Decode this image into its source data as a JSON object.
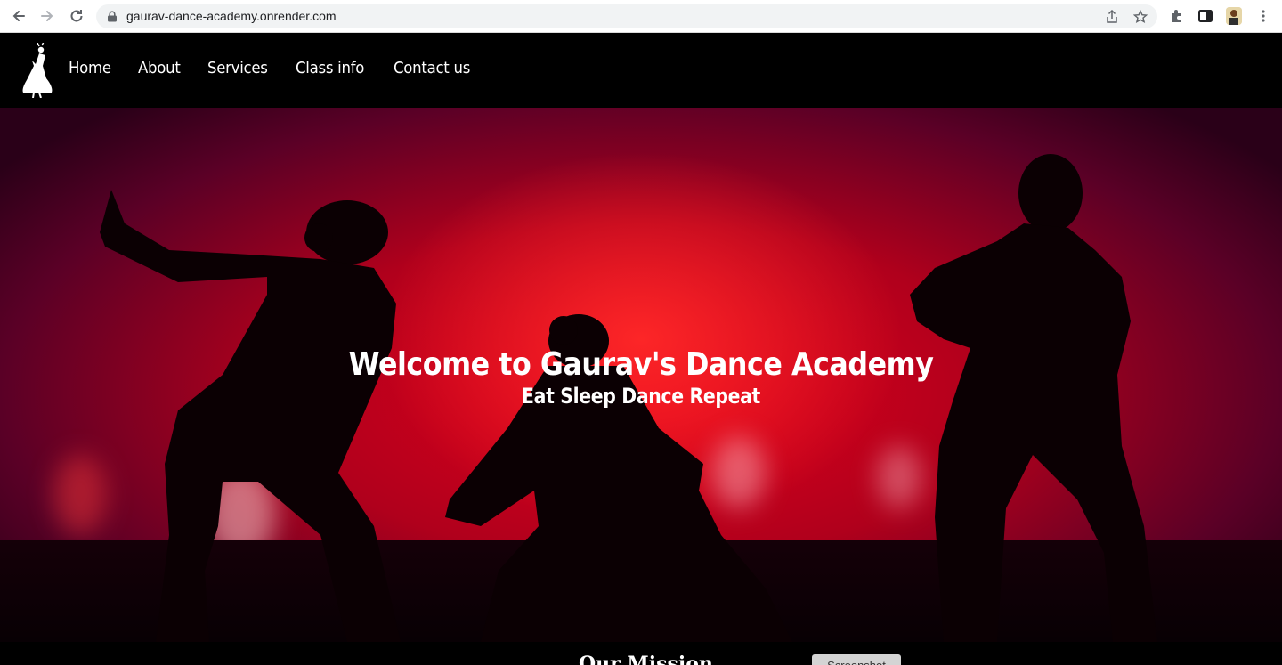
{
  "browser": {
    "url": "gaurav-dance-academy.onrender.com",
    "icons": [
      "back-icon",
      "forward-icon",
      "reload-icon",
      "lock-icon",
      "share-icon",
      "bookmark-star-icon",
      "extensions-icon",
      "side-panel-icon",
      "profile-avatar",
      "more-menu-icon"
    ]
  },
  "nav": {
    "logo_icon": "dancer-logo-icon",
    "links": [
      "Home",
      "About",
      "Services",
      "Class info",
      "Contact us"
    ]
  },
  "hero": {
    "title": "Welcome to Gaurav's Dance Academy",
    "subtitle": "Eat Sleep Dance Repeat",
    "colors": {
      "primary": "#e0001a",
      "dark": "#2a0018"
    }
  },
  "mission": {
    "title": "Our Mission",
    "button_label": "Screenshot"
  }
}
